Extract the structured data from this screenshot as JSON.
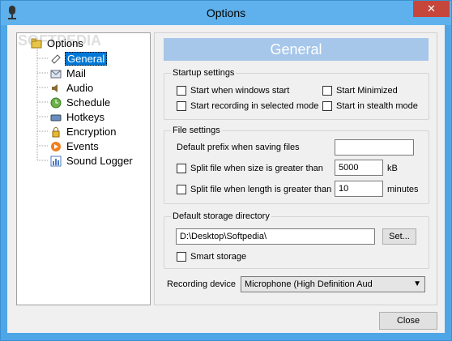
{
  "window": {
    "title": "Options",
    "close_glyph": "✕"
  },
  "watermark": "SOFTPEDIA",
  "tree": {
    "root": "Options",
    "items": [
      {
        "label": "General",
        "icon": "general-icon",
        "selected": true
      },
      {
        "label": "Mail",
        "icon": "mail-icon"
      },
      {
        "label": "Audio",
        "icon": "audio-icon"
      },
      {
        "label": "Schedule",
        "icon": "schedule-icon"
      },
      {
        "label": "Hotkeys",
        "icon": "hotkeys-icon"
      },
      {
        "label": "Encryption",
        "icon": "lock-icon"
      },
      {
        "label": "Events",
        "icon": "events-icon"
      },
      {
        "label": "Sound Logger",
        "icon": "sound-logger-icon"
      }
    ]
  },
  "panel": {
    "header": "General"
  },
  "startup": {
    "title": "Startup settings",
    "start_windows": "Start when windows start",
    "start_minimized": "Start Minimized",
    "start_recording": "Start recording in selected mode",
    "start_stealth": "Start in stealth mode"
  },
  "file": {
    "title": "File settings",
    "prefix_label": "Default prefix when saving files",
    "prefix_value": "",
    "split_size_label": "Split file when size is greater than",
    "split_size_value": "5000",
    "split_size_unit": "kB",
    "split_length_label": "Split file when length is greater than",
    "split_length_value": "10",
    "split_length_unit": "minutes"
  },
  "storage": {
    "title": "Default storage directory",
    "path": "D:\\Desktop\\Softpedia\\",
    "set_label": "Set...",
    "smart_storage": "Smart storage"
  },
  "recording": {
    "label": "Recording device",
    "device": "Microphone (High Definition Aud"
  },
  "footer": {
    "close_label": "Close"
  }
}
